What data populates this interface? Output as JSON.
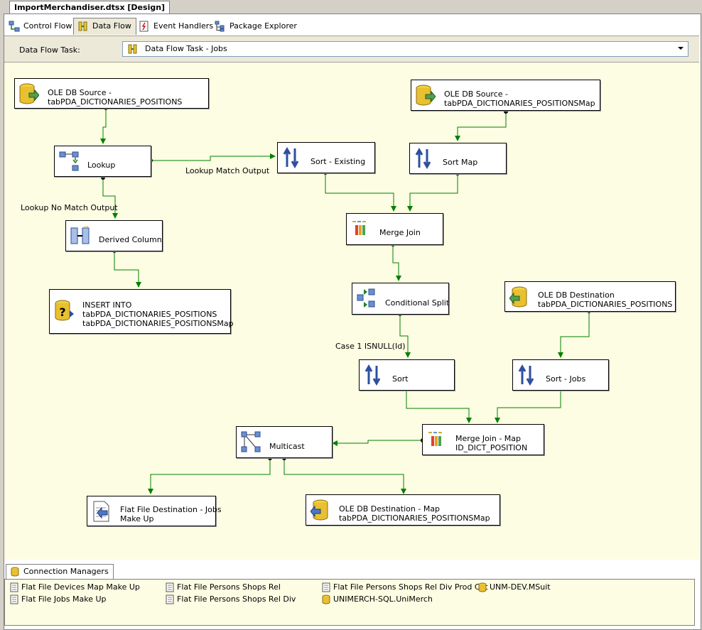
{
  "document_tab": "ImportMerchandiser.dtsx [Design]",
  "tabs": [
    {
      "label": "Control Flow",
      "icon": "control-flow-icon"
    },
    {
      "label": "Data Flow",
      "icon": "data-flow-icon"
    },
    {
      "label": "Event Handlers",
      "icon": "event-handlers-icon"
    },
    {
      "label": "Package Explorer",
      "icon": "package-explorer-icon"
    }
  ],
  "active_tab": "Data Flow",
  "task": {
    "label": "Data Flow Task:",
    "value": "Data Flow Task - Jobs"
  },
  "components": [
    {
      "id": "src1",
      "lines": [
        "OLE DB Source -",
        "tabPDA_DICTIONARIES_POSITIONS"
      ],
      "icon": "database-source-icon"
    },
    {
      "id": "src2",
      "lines": [
        "OLE DB Source -",
        "tabPDA_DICTIONARIES_POSITIONSMap"
      ],
      "icon": "database-source-icon"
    },
    {
      "id": "lookup",
      "lines": [
        "Lookup"
      ],
      "icon": "lookup-icon"
    },
    {
      "id": "sort_existing",
      "lines": [
        "Sort - Existing"
      ],
      "icon": "sort-icon"
    },
    {
      "id": "sort_map",
      "lines": [
        "Sort Map"
      ],
      "icon": "sort-icon"
    },
    {
      "id": "derived",
      "lines": [
        "Derived Column"
      ],
      "icon": "derived-column-icon"
    },
    {
      "id": "merge1",
      "lines": [
        "Merge Join"
      ],
      "icon": "merge-join-icon"
    },
    {
      "id": "insert",
      "lines": [
        "INSERT INTO",
        "tabPDA_DICTIONARIES_POSITIONS",
        "tabPDA_DICTIONARIES_POSITIONSMap"
      ],
      "icon": "database-unknown-icon"
    },
    {
      "id": "csplit",
      "lines": [
        "Conditional Split"
      ],
      "icon": "conditional-split-icon"
    },
    {
      "id": "dest1",
      "lines": [
        "OLE DB Destination",
        "tabPDA_DICTIONARIES_POSITIONS"
      ],
      "icon": "database-destination-icon"
    },
    {
      "id": "sort",
      "lines": [
        "Sort"
      ],
      "icon": "sort-icon"
    },
    {
      "id": "sort_jobs",
      "lines": [
        "Sort - Jobs"
      ],
      "icon": "sort-icon"
    },
    {
      "id": "multicast",
      "lines": [
        "Multicast"
      ],
      "icon": "multicast-icon"
    },
    {
      "id": "merge2",
      "lines": [
        "Merge Join  - Map",
        "ID_DICT_POSITION"
      ],
      "icon": "merge-join-icon"
    },
    {
      "id": "flatdest",
      "lines": [
        "Flat File Destination - Jobs",
        "Make Up"
      ],
      "icon": "flat-file-destination-icon"
    },
    {
      "id": "dest2",
      "lines": [
        "OLE DB Destination - Map",
        "tabPDA_DICTIONARIES_POSITIONSMap"
      ],
      "icon": "database-destination-icon"
    }
  ],
  "path_labels": [
    "Lookup Match Output",
    "Lookup No Match Output",
    "Case 1 ISNULL(Id)"
  ],
  "connection_managers": {
    "tab_label": "Connection Managers",
    "items": [
      {
        "label": "Flat File Devices Map Make Up",
        "type": "flat-file"
      },
      {
        "label": "Flat File Jobs Make Up",
        "type": "flat-file"
      },
      {
        "label": "Flat File Persons Shops Rel",
        "type": "flat-file"
      },
      {
        "label": "Flat File Persons Shops Rel Div",
        "type": "flat-file"
      },
      {
        "label": "Flat File Persons Shops Rel Div Prod Cat",
        "type": "flat-file"
      },
      {
        "label": "UNIMERCH-SQL.UniMerch",
        "type": "oledb"
      },
      {
        "label": "UNM-DEV.MSuit",
        "type": "oledb"
      }
    ]
  },
  "colors": {
    "canvas": "#fdfde3",
    "path": "#008000",
    "chrome": "#ece9d8"
  }
}
